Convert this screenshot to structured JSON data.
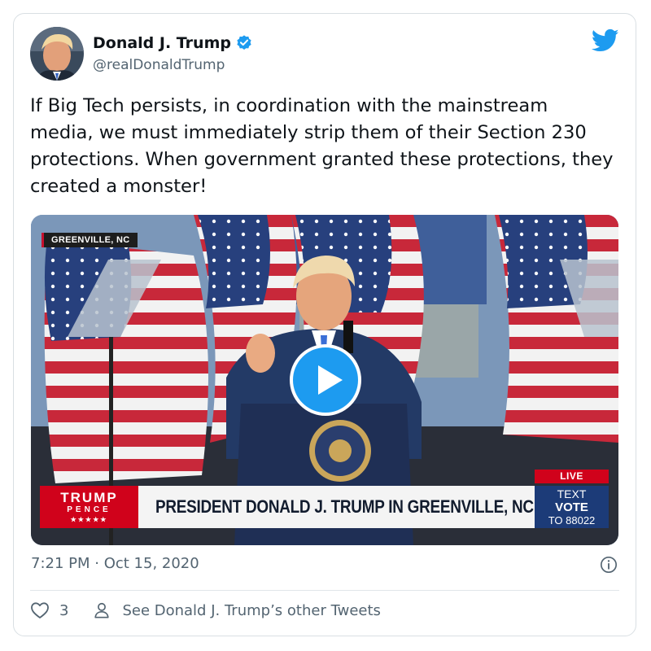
{
  "author": {
    "name": "Donald J. Trump",
    "handle": "@realDonaldTrump"
  },
  "tweet": {
    "text": "If Big Tech persists, in coordination with the mainstream media, we must immediately strip them of their Section 230 protections. When government granted these protections, they created a monster!",
    "timestamp": "7:21 PM · Oct 15, 2020"
  },
  "video": {
    "location_tag": "GREENVILLE, NC",
    "live_label": "LIVE",
    "headline": "PRESIDENT DONALD J. TRUMP IN GREENVILLE, NC",
    "logo": {
      "line1": "TRUMP",
      "line2": "PENCE",
      "stars": "★★★★★"
    },
    "cta": {
      "line1": "TEXT",
      "line2": "VOTE",
      "line3": "TO 88022"
    }
  },
  "footer": {
    "likes_count": "3",
    "other_tweets_label": "See Donald J. Trump’s other Tweets"
  },
  "icons": {
    "bird": "twitter-bird-icon",
    "verified": "verified-badge-icon",
    "info": "info-icon",
    "heart": "heart-icon",
    "person": "person-icon",
    "play": "play-icon"
  },
  "colors": {
    "brand_blue": "#1d9bf0",
    "text": "#0f1419",
    "muted": "#536471",
    "live_red": "#d0021b",
    "vote_blue": "#1c3b78"
  }
}
